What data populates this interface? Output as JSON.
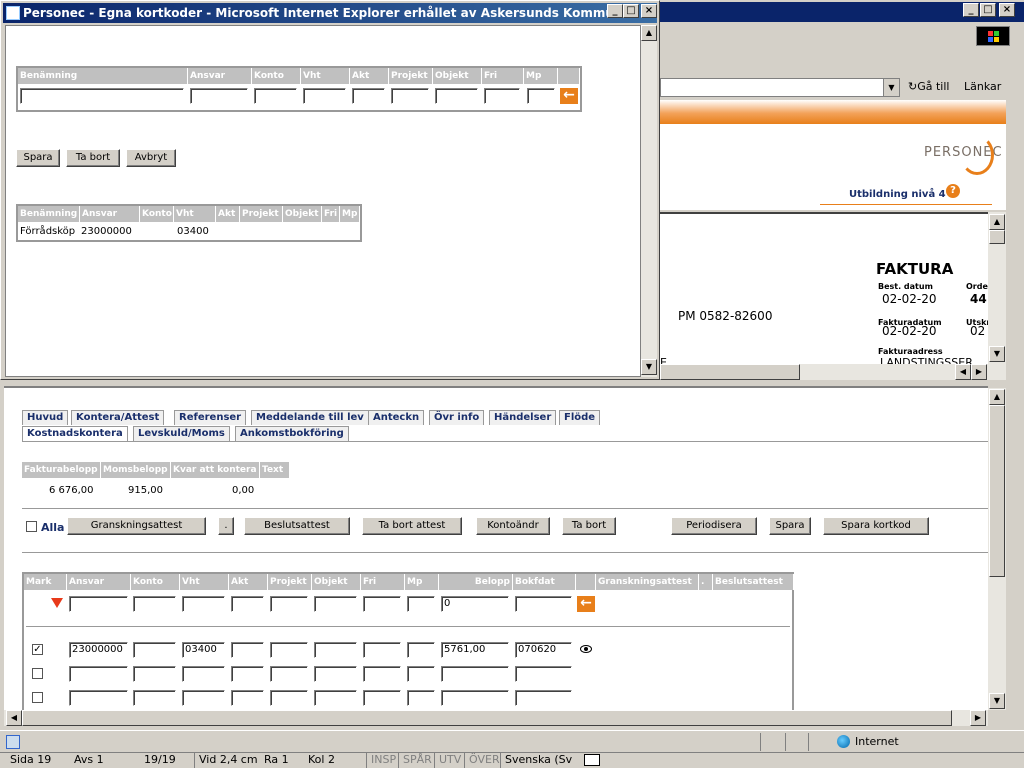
{
  "popup": {
    "title": "Personec - Egna kortkoder - Microsoft Internet Explorer erhållet av Askersunds Kommun",
    "edit_headers": [
      "Benämning",
      "Ansvar",
      "Konto",
      "Vht",
      "Akt",
      "Projekt",
      "Objekt",
      "Fri",
      "Mp"
    ],
    "buttons": {
      "save": "Spara",
      "delete": "Ta bort",
      "cancel": "Avbryt"
    },
    "list_headers": [
      "Benämning",
      "Ansvar",
      "Konto",
      "Vht",
      "Akt",
      "Projekt",
      "Objekt",
      "Fri",
      "Mp"
    ],
    "list_row": {
      "benamning": "Förrådsköp",
      "ansvar": "23000000",
      "vht": "03400"
    }
  },
  "browser": {
    "goto_label": "Gå till",
    "links_label": "Länkar",
    "logo_text": "PERSONEC",
    "level_text": "Utbildning nivå 4"
  },
  "invoice": {
    "title": "FAKTURA",
    "best_datum_label": "Best. datum",
    "best_datum": "02-02-20",
    "order_label": "Orde",
    "order_value": "44",
    "faktura_datum_label": "Fakturadatum",
    "faktura_datum": "02-02-20",
    "utskr_label": "Utskr",
    "utskr_value": "02",
    "pm": "PM  0582-82600",
    "fakturaadress_label": "Fakturaadress",
    "address_partial": "LANDSTINGSSER",
    "left_char_e": "E"
  },
  "main": {
    "tabs_row1": [
      "Huvud",
      "Kontera/Attest",
      "Referenser",
      "Meddelande till lev",
      "Anteckn",
      "Övr info",
      "Händelser",
      "Flöde"
    ],
    "tabs_row2": [
      "Kostnadskontera",
      "Levskuld/Moms",
      "Ankomstbokföring"
    ],
    "summary_headers": [
      "Fakturabelopp",
      "Momsbelopp",
      "Kvar att kontera",
      "Text"
    ],
    "summary_values": {
      "fakturabelopp": "6 676,00",
      "momsbelopp": "915,00",
      "kvar": "0,00"
    },
    "alla_label": "Alla",
    "action_buttons": [
      "Granskningsattest",
      ".",
      "Beslutsattest",
      "Ta bort attest",
      "Kontoändr",
      "Ta bort",
      "Periodisera",
      "Spara",
      "Spara kortkod"
    ],
    "grid_headers": [
      "Mark",
      "Ansvar",
      "Konto",
      "Vht",
      "Akt",
      "Projekt",
      "Objekt",
      "Fri",
      "Mp",
      "Belopp",
      "Bokfdat",
      "",
      "Granskningsattest",
      ".",
      "Beslutsattest"
    ],
    "filter_belopp": "0",
    "row1": {
      "ansvar": "23000000",
      "vht": "03400",
      "belopp": "5761,00",
      "bokfdat": "070620"
    }
  },
  "statusbar": {
    "zone": "Internet",
    "sida": "Sida  19",
    "avs": "Avs  1",
    "pages": "19/19",
    "vid": "Vid  2,4 cm",
    "ra": "Ra  1",
    "kol": "Kol  2",
    "insp": "INSP",
    "spar": "SPÅR",
    "utv": "UTV",
    "over": "ÖVER",
    "lang": "Svenska (Sv"
  },
  "colors": {
    "accent": "#e87f1a",
    "title_bar": "#0a246a",
    "tab_text": "#1a2f6b"
  }
}
